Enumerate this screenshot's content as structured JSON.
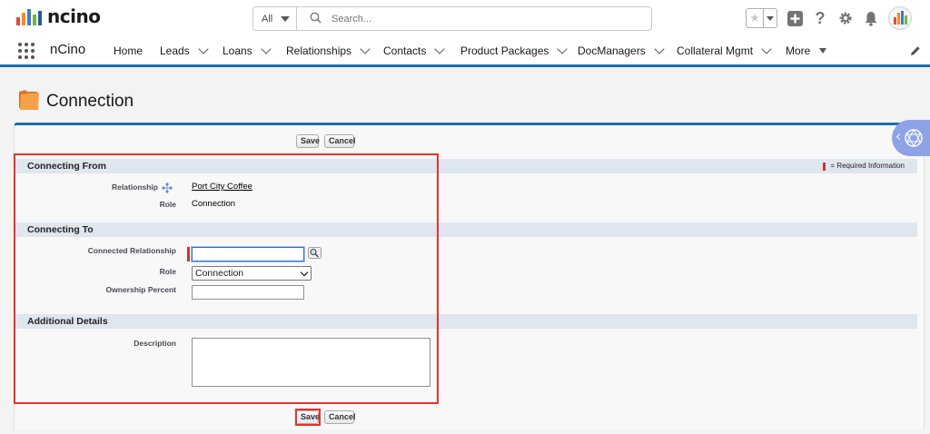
{
  "header": {
    "logo_text": "ncino",
    "search_scope": "All",
    "search_placeholder": "Search..."
  },
  "nav": {
    "app_name": "nCino",
    "items": [
      {
        "label": "Home"
      },
      {
        "label": "Leads"
      },
      {
        "label": "Loans"
      },
      {
        "label": "Relationships"
      },
      {
        "label": "Contacts"
      },
      {
        "label": "Product Packages"
      },
      {
        "label": "DocManagers"
      },
      {
        "label": "Collateral Mgmt"
      },
      {
        "label": "More"
      }
    ]
  },
  "page": {
    "title": "Connection"
  },
  "buttons": {
    "save": "Save",
    "cancel": "Cancel"
  },
  "sections": {
    "from": {
      "title": "Connecting From",
      "required_legend": "= Required Information",
      "relationship_label": "Relationship",
      "relationship_value": "Port City Coffee",
      "role_label": "Role",
      "role_value": "Connection"
    },
    "to": {
      "title": "Connecting To",
      "connected_label": "Connected Relationship",
      "connected_value": "",
      "role_label": "Role",
      "role_value": "Connection",
      "ownership_label": "Ownership Percent",
      "ownership_value": ""
    },
    "details": {
      "title": "Additional Details",
      "description_label": "Description",
      "description_value": ""
    }
  },
  "colors": {
    "brand_blue": "#1b6eb5",
    "required_red": "#c23934",
    "highlight_red": "#e8322b",
    "section_bg": "#dfe6ee"
  },
  "icons": [
    "search-icon",
    "star-icon",
    "add-icon",
    "help-icon",
    "gear-icon",
    "bell-icon",
    "waffle-icon",
    "pencil-icon",
    "folder-icon",
    "hierarchy-icon",
    "lookup-icon",
    "network-icon"
  ]
}
